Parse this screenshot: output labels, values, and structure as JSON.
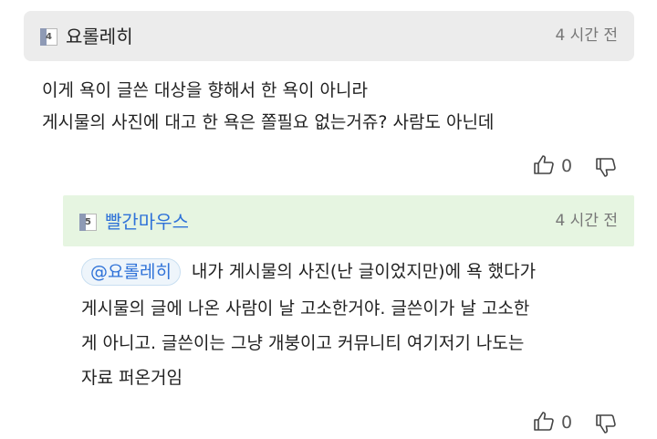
{
  "comment": {
    "level_badge": "4",
    "username": "요롤레히",
    "time": "4 시간 전",
    "lines": [
      "이게 욕이 글쓴 대상을 향해서 한 욕이 아니라",
      "게시물의 사진에 대고 한 욕은 쫄필요 없는거쥬? 사람도 아닌데"
    ],
    "likes": "0"
  },
  "reply": {
    "level_badge": "5",
    "username": "빨간마우스",
    "time": "4 시간 전",
    "mention": "@요롤레히",
    "lines": [
      "내가 게시물의 사진(난 글이었지만)에 욕 했다가",
      "게시물의 글에 나온 사람이 날 고소한거야. 글쓴이가 날 고소한",
      "게 아니고. 글쓴이는 그냥 개붕이고 커뮤니티 여기저기 나도는",
      "자료 퍼온거임"
    ],
    "likes": "0"
  },
  "icons": {
    "level_badge": "level-badge-icon",
    "like": "thumbs-up-icon",
    "dislike": "thumbs-down-icon"
  }
}
